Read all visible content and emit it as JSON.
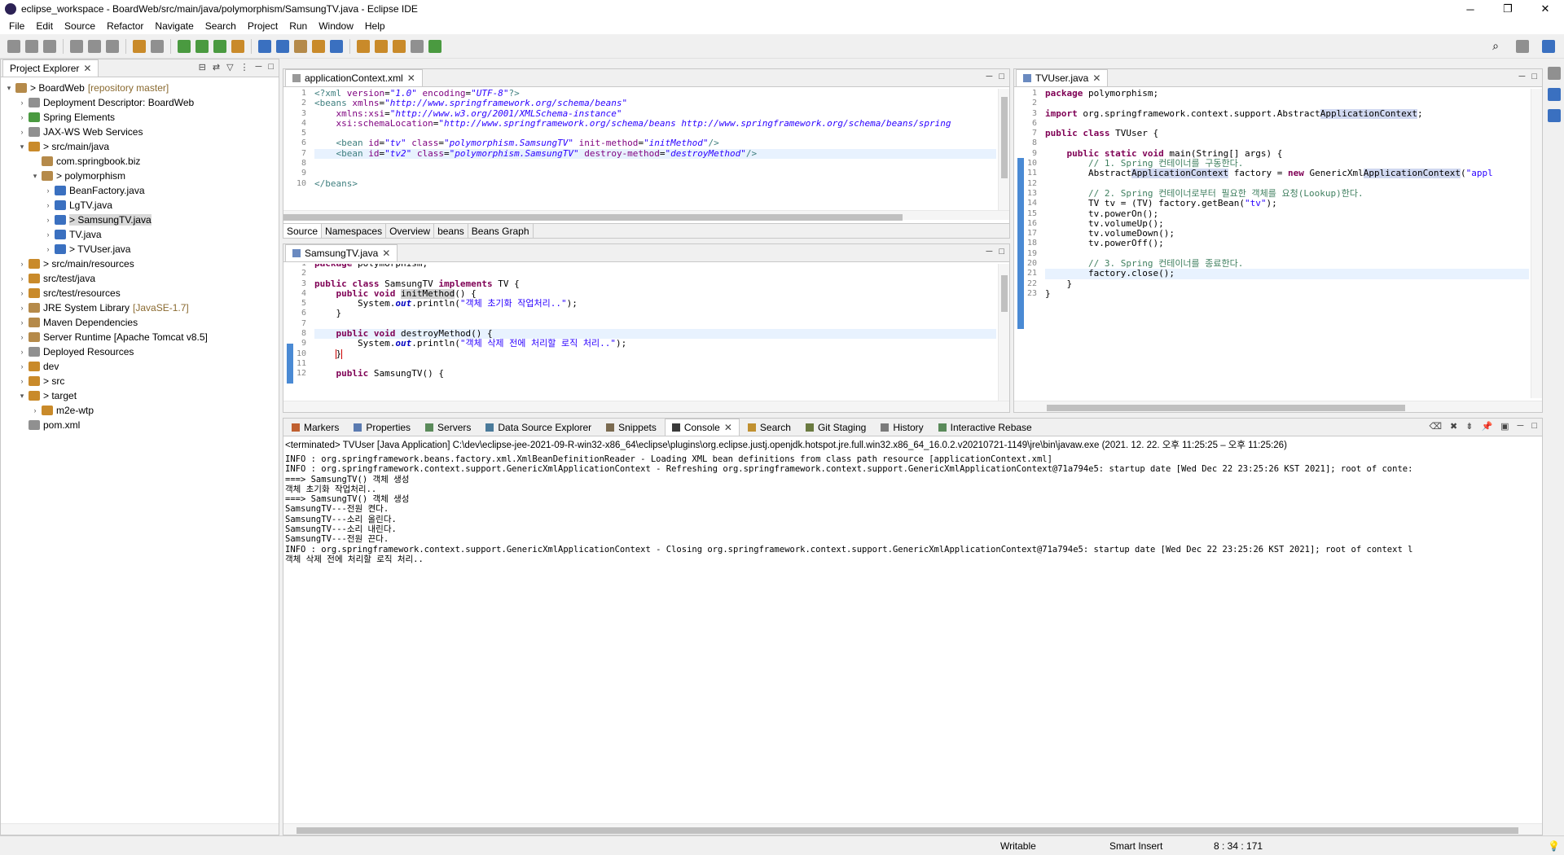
{
  "window": {
    "title": "eclipse_workspace - BoardWeb/src/main/java/polymorphism/SamsungTV.java - Eclipse IDE",
    "minimize": "─",
    "maximize": "❐",
    "close": "✕"
  },
  "menu": [
    "File",
    "Edit",
    "Source",
    "Refactor",
    "Navigate",
    "Search",
    "Project",
    "Run",
    "Window",
    "Help"
  ],
  "project_explorer": {
    "tab": "Project Explorer",
    "items": [
      {
        "label": "> BoardWeb",
        "extra": "[repository master]",
        "depth": 0,
        "arrow": "▾"
      },
      {
        "label": "Deployment Descriptor: BoardWeb",
        "extra": "",
        "depth": 1,
        "arrow": "›"
      },
      {
        "label": "Spring Elements",
        "extra": "",
        "depth": 1,
        "arrow": "›"
      },
      {
        "label": "JAX-WS Web Services",
        "extra": "",
        "depth": 1,
        "arrow": "›"
      },
      {
        "label": "> src/main/java",
        "extra": "",
        "depth": 1,
        "arrow": "▾"
      },
      {
        "label": "com.springbook.biz",
        "extra": "",
        "depth": 2,
        "arrow": ""
      },
      {
        "label": "> polymorphism",
        "extra": "",
        "depth": 2,
        "arrow": "▾"
      },
      {
        "label": "BeanFactory.java",
        "extra": "",
        "depth": 3,
        "arrow": "›"
      },
      {
        "label": "LgTV.java",
        "extra": "",
        "depth": 3,
        "arrow": "›"
      },
      {
        "label": "> SamsungTV.java",
        "extra": "",
        "depth": 3,
        "arrow": "›",
        "selected": true
      },
      {
        "label": "TV.java",
        "extra": "",
        "depth": 3,
        "arrow": "›"
      },
      {
        "label": "> TVUser.java",
        "extra": "",
        "depth": 3,
        "arrow": "›"
      },
      {
        "label": "> src/main/resources",
        "extra": "",
        "depth": 1,
        "arrow": "›"
      },
      {
        "label": "src/test/java",
        "extra": "",
        "depth": 1,
        "arrow": "›"
      },
      {
        "label": "src/test/resources",
        "extra": "",
        "depth": 1,
        "arrow": "›"
      },
      {
        "label": "JRE System Library",
        "extra": "[JavaSE-1.7]",
        "depth": 1,
        "arrow": "›"
      },
      {
        "label": "Maven Dependencies",
        "extra": "",
        "depth": 1,
        "arrow": "›"
      },
      {
        "label": "Server Runtime [Apache Tomcat v8.5]",
        "extra": "",
        "depth": 1,
        "arrow": "›"
      },
      {
        "label": "Deployed Resources",
        "extra": "",
        "depth": 1,
        "arrow": "›"
      },
      {
        "label": "dev",
        "extra": "",
        "depth": 1,
        "arrow": "›"
      },
      {
        "label": "> src",
        "extra": "",
        "depth": 1,
        "arrow": "›"
      },
      {
        "label": "> target",
        "extra": "",
        "depth": 1,
        "arrow": "▾"
      },
      {
        "label": "m2e-wtp",
        "extra": "",
        "depth": 2,
        "arrow": "›"
      },
      {
        "label": "pom.xml",
        "extra": "",
        "depth": 1,
        "arrow": ""
      }
    ]
  },
  "xml_editor": {
    "tab": "applicationContext.xml",
    "subtabs": [
      "Source",
      "Namespaces",
      "Overview",
      "beans",
      "Beans Graph"
    ],
    "line_numbers": [
      "1",
      "2",
      "3",
      "4",
      "5",
      "6",
      "7",
      "8",
      "9",
      "10"
    ]
  },
  "samsung_editor": {
    "tab": "SamsungTV.java",
    "line_numbers": [
      "1",
      "2",
      "3",
      "4",
      "5",
      "6",
      "7",
      "8",
      "9",
      "10",
      "11",
      "12"
    ]
  },
  "tvuser_editor": {
    "tab": "TVUser.java",
    "line_numbers": [
      "1",
      "2",
      "3",
      "6",
      "7",
      "8",
      "9",
      "10",
      "11",
      "12",
      "13",
      "14",
      "15",
      "16",
      "17",
      "18",
      "19",
      "20",
      "21",
      "22",
      "23"
    ]
  },
  "bottom_tabs": [
    "Markers",
    "Properties",
    "Servers",
    "Data Source Explorer",
    "Snippets",
    "Console",
    "Search",
    "Git Staging",
    "History",
    "Interactive Rebase"
  ],
  "console": {
    "header": "<terminated> TVUser [Java Application] C:\\dev\\eclipse-jee-2021-09-R-win32-x86_64\\eclipse\\plugins\\org.eclipse.justj.openjdk.hotspot.jre.full.win32.x86_64_16.0.2.v20210721-1149\\jre\\bin\\javaw.exe  (2021. 12. 22. 오후 11:25:25 – 오후 11:25:26)",
    "lines": [
      "INFO : org.springframework.beans.factory.xml.XmlBeanDefinitionReader - Loading XML bean definitions from class path resource [applicationContext.xml]",
      "INFO : org.springframework.context.support.GenericXmlApplicationContext - Refreshing org.springframework.context.support.GenericXmlApplicationContext@71a794e5: startup date [Wed Dec 22 23:25:26 KST 2021]; root of conte:",
      "===> SamsungTV() 객체 생성",
      "객체 초기화 작업처리..",
      "===> SamsungTV() 객체 생성",
      "SamsungTV---전원 켠다.",
      "SamsungTV---소리 올린다.",
      "SamsungTV---소리 내린다.",
      "SamsungTV---전원 끈다.",
      "INFO : org.springframework.context.support.GenericXmlApplicationContext - Closing org.springframework.context.support.GenericXmlApplicationContext@71a794e5: startup date [Wed Dec 22 23:25:26 KST 2021]; root of context l",
      "객체 삭제 전에 처리할 로직 처리.."
    ]
  },
  "status": {
    "writable": "Writable",
    "insert_mode": "Smart Insert",
    "position": "8 : 34 : 171"
  }
}
